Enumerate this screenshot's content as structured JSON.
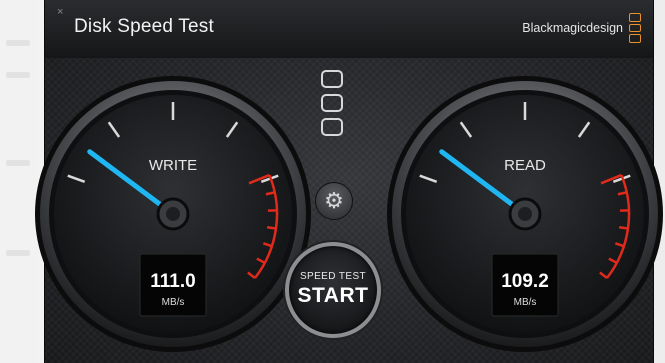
{
  "window": {
    "title": "Disk Speed Test",
    "close_glyph": "×",
    "brand": "Blackmagicdesign",
    "brand_color": "#e8902c"
  },
  "gauges": {
    "write": {
      "label": "WRITE",
      "value": "111.0",
      "unit": "MB/s",
      "needle_level": 0.12
    },
    "read": {
      "label": "READ",
      "value": "109.2",
      "unit": "MB/s",
      "needle_level": 0.12
    },
    "needle_color": "#1fb6f2",
    "redline_color": "#e02a1c"
  },
  "controls": {
    "start_small": "SPEED TEST",
    "start_big": "START",
    "settings_icon": "gear-icon",
    "slot_icon": "target-slot-icon"
  }
}
